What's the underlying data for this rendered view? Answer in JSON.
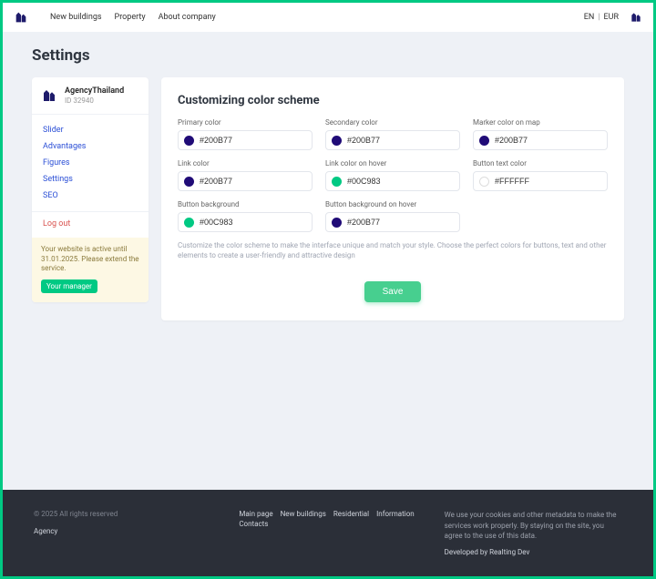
{
  "topnav": {
    "items": [
      "New buildings",
      "Property",
      "About company"
    ],
    "lang": "EN",
    "currency": "EUR"
  },
  "page": {
    "title": "Settings"
  },
  "profile": {
    "name": "AgencyThailand",
    "id_label": "ID 32940"
  },
  "side_nav": [
    "Slider",
    "Advantages",
    "Figures",
    "Settings",
    "SEO"
  ],
  "logout_label": "Log out",
  "notice": {
    "line1": "Your website is active until 31.01.2025.",
    "line2": "Please extend the service.",
    "button": "Your manager"
  },
  "panel": {
    "title": "Customizing color scheme",
    "fields": [
      {
        "label": "Primary color",
        "value": "#200B77",
        "swatch": "#200B77"
      },
      {
        "label": "Secondary color",
        "value": "#200B77",
        "swatch": "#200B77"
      },
      {
        "label": "Marker color on map",
        "value": "#200B77",
        "swatch": "#200B77"
      },
      {
        "label": "Link color",
        "value": "#200B77",
        "swatch": "#200B77"
      },
      {
        "label": "Link color on hover",
        "value": "#00C983",
        "swatch": "#00C983"
      },
      {
        "label": "Button text color",
        "value": "#FFFFFF",
        "swatch": "#FFFFFF"
      },
      {
        "label": "Button background",
        "value": "#00C983",
        "swatch": "#00C983"
      },
      {
        "label": "Button background on hover",
        "value": "#200B77",
        "swatch": "#200B77"
      }
    ],
    "help": "Customize the color scheme to make the interface unique and match your style. Choose the perfect colors for buttons, text and other elements to create a user-friendly and attractive design",
    "save": "Save"
  },
  "footer": {
    "copyright": "© 2025 All rights reserved",
    "agency": "Agency",
    "links": [
      "Main page",
      "New buildings",
      "Residential",
      "Information",
      "Contacts"
    ],
    "policy": "We use your cookies and other metadata to make the services work properly. By staying on the site, you agree to the use of this data.",
    "dev": "Developed by Realting Dev"
  }
}
